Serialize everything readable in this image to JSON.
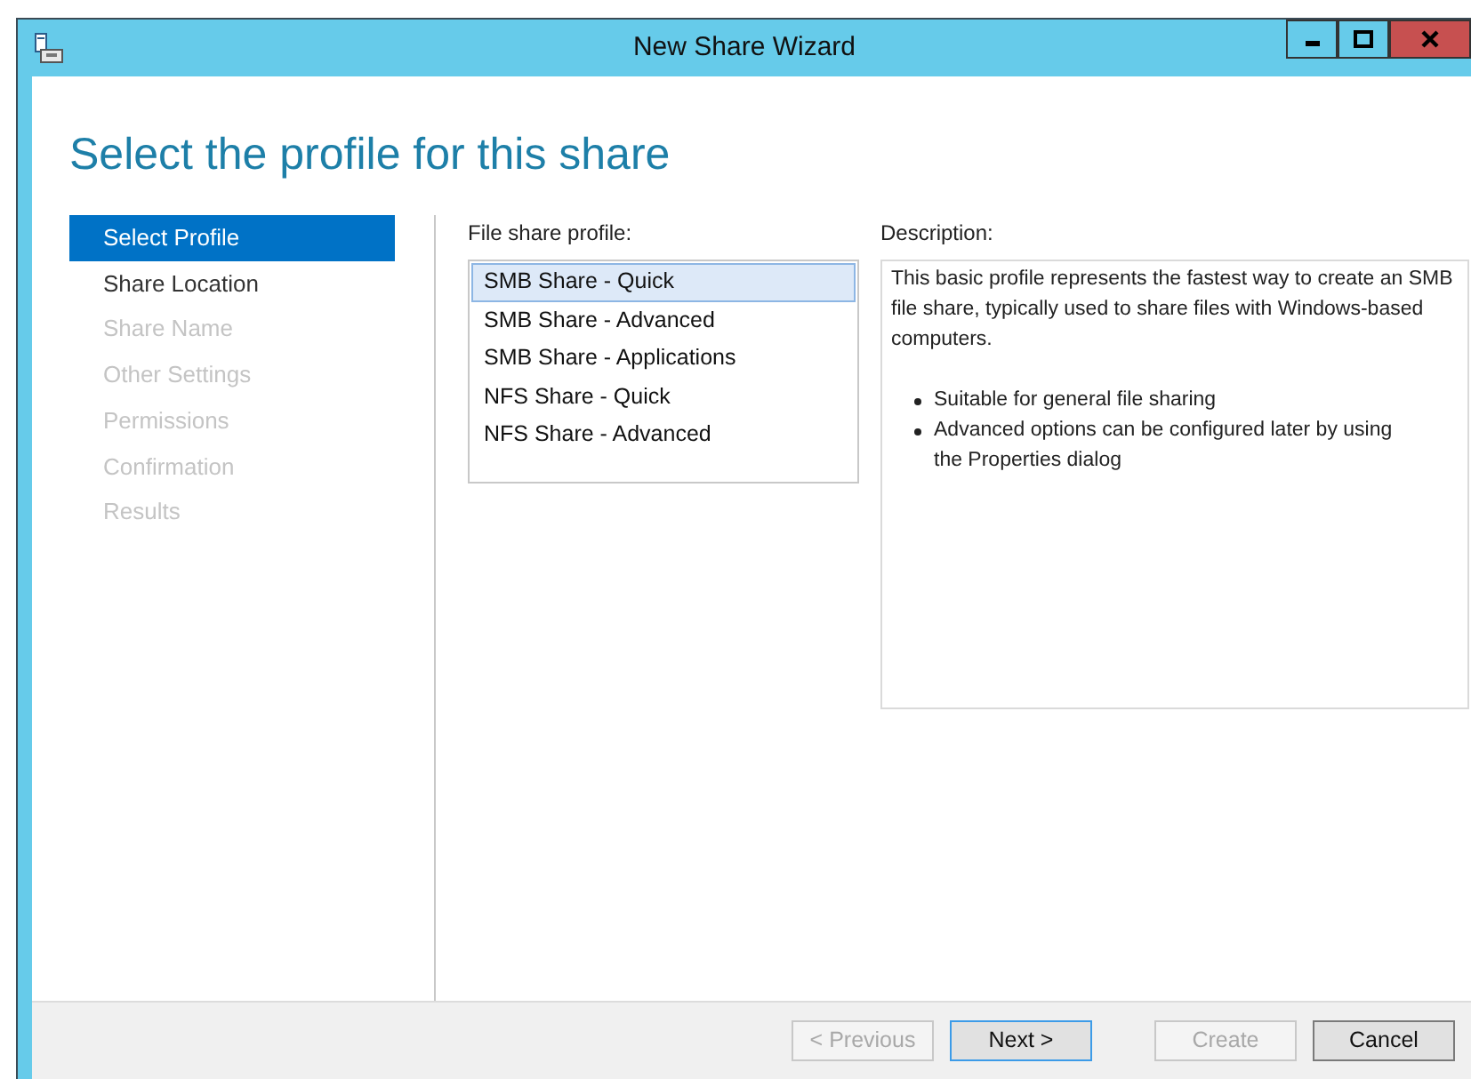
{
  "window": {
    "title": "New Share Wizard",
    "controls": [
      {
        "kind": "minimize"
      },
      {
        "kind": "maximize"
      },
      {
        "kind": "close"
      }
    ]
  },
  "heading": "Select the profile for this share",
  "steps": [
    {
      "label": "Select Profile",
      "selected": true,
      "disabled": false
    },
    {
      "label": "Share Location",
      "selected": false,
      "disabled": false
    },
    {
      "label": "Share Name",
      "selected": false,
      "disabled": true
    },
    {
      "label": "Other Settings",
      "selected": false,
      "disabled": true
    },
    {
      "label": "Permissions",
      "selected": false,
      "disabled": true
    },
    {
      "label": "Confirmation",
      "selected": false,
      "disabled": true
    },
    {
      "label": "Results",
      "selected": false,
      "disabled": true
    }
  ],
  "profiles": {
    "label": "File share profile:",
    "items": [
      {
        "label": "SMB Share - Quick",
        "selected": true
      },
      {
        "label": "SMB Share - Advanced",
        "selected": false
      },
      {
        "label": "SMB Share - Applications",
        "selected": false
      },
      {
        "label": "NFS Share - Quick",
        "selected": false
      },
      {
        "label": "NFS Share - Advanced",
        "selected": false
      }
    ]
  },
  "description": {
    "label": "Description:",
    "text": "This basic profile represents the fastest way to create an SMB file share, typically used to share files with Windows-based computers.",
    "bullets": [
      "Suitable for general file sharing",
      "Advanced options can be configured later by using the Properties dialog"
    ]
  },
  "buttons": [
    {
      "label": "< Previous",
      "disabled": true,
      "default": false
    },
    {
      "label": "Next >",
      "disabled": false,
      "default": true
    },
    {
      "label": "Create",
      "disabled": true,
      "default": false
    },
    {
      "label": "Cancel",
      "disabled": false,
      "default": false
    }
  ]
}
